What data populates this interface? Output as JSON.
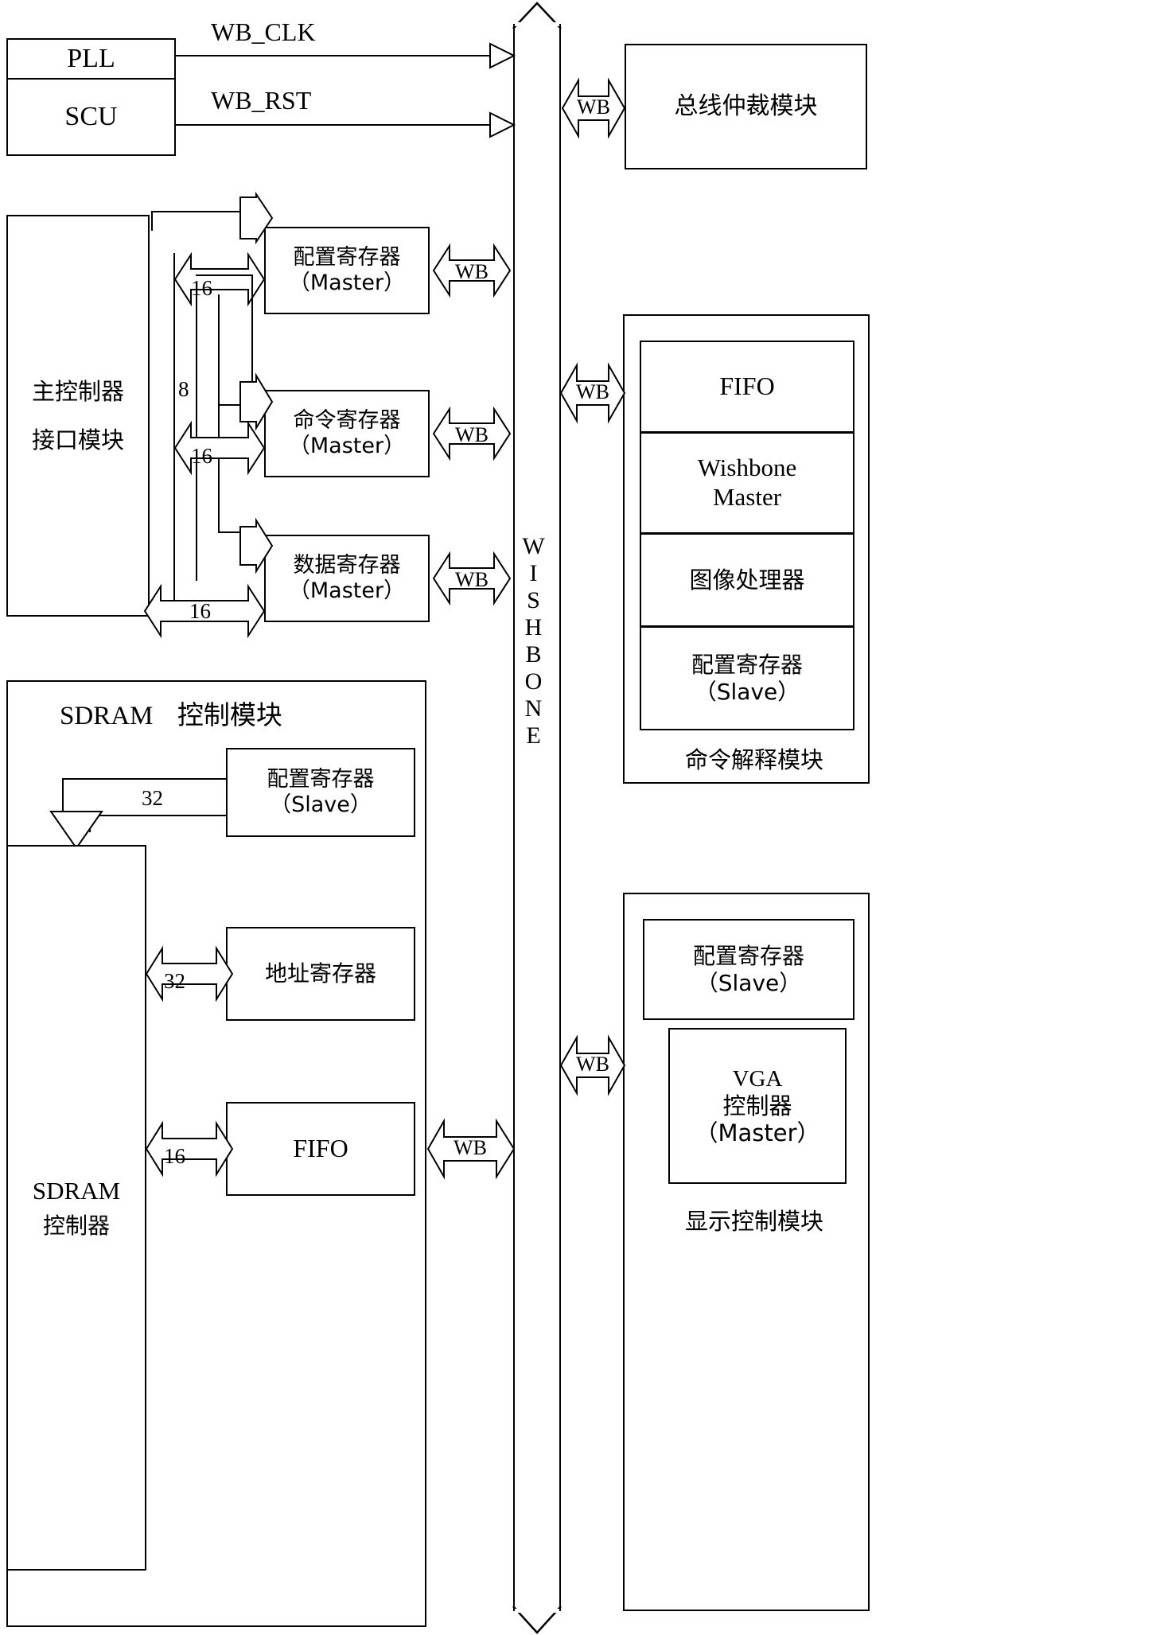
{
  "diagram": {
    "title": "SoC Wishbone bus block diagram",
    "bus": {
      "label": "WISHBONE",
      "wb_tag": "WB"
    },
    "clock_block": {
      "top_label": "PLL",
      "bottom_label": "SCU"
    },
    "clock_signals": [
      {
        "name": "WB_CLK"
      },
      {
        "name": "WB_RST"
      }
    ],
    "arbiter_module": {
      "label": "总线仲裁模块",
      "wb_tag": "WB"
    },
    "host_interface": {
      "line1": "主控制器",
      "line2": "接口模块"
    },
    "master_registers": [
      {
        "line1": "配置寄存器",
        "line2": "（Master）",
        "bus_widths": [
          "16"
        ],
        "wb_tag": "WB"
      },
      {
        "line1": "命令寄存器",
        "line2": "（Master）",
        "bus_widths": [
          "8",
          "16"
        ],
        "wb_tag": "WB"
      },
      {
        "line1": "数据寄存器",
        "line2": "（Master）",
        "bus_widths": [
          "16"
        ],
        "wb_tag": "WB"
      }
    ],
    "command_module": {
      "label": "命令解释模块",
      "wb_tag": "WB",
      "blocks": [
        {
          "line1": "FIFO",
          "line2": ""
        },
        {
          "line1": "Wishbone",
          "line2": "Master"
        },
        {
          "line1": "图像处理器",
          "line2": ""
        },
        {
          "line1": "配置寄存器",
          "line2": "（Slave）"
        }
      ]
    },
    "sdram_module": {
      "title_en": "SDRAM",
      "title_zh": "控制模块",
      "controller": {
        "line1": "SDRAM",
        "line2": "控制器"
      },
      "config_register": {
        "line1": "配置寄存器",
        "line2": "（Slave）",
        "bus_width": "32"
      },
      "address_register": {
        "line1": "地址寄存器",
        "bus_width": "32"
      },
      "fifo": {
        "line1": "FIFO",
        "bus_width": "16",
        "wb_tag": "WB"
      }
    },
    "display_module": {
      "label": "显示控制模块",
      "wb_tag": "WB",
      "config_register": {
        "line1": "配置寄存器",
        "line2": "（Slave）"
      },
      "vga": {
        "line1": "VGA",
        "line2": "控制器",
        "line3": "（Master）"
      }
    }
  }
}
